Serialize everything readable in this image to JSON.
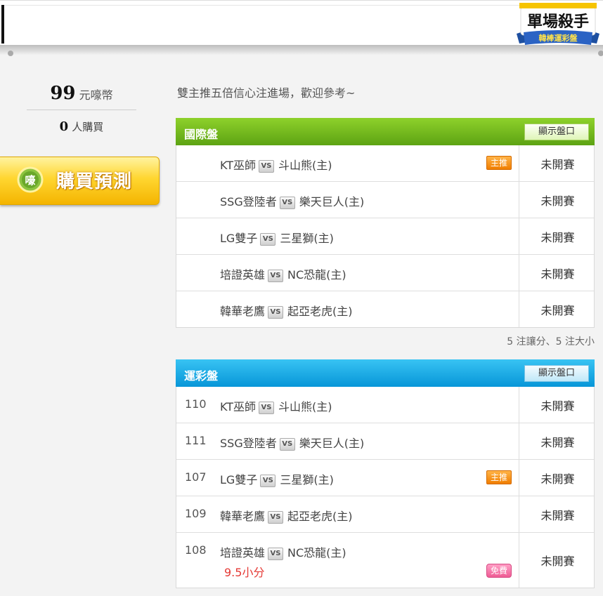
{
  "badge": {
    "line1": "單場殺手",
    "line2": "韓棒運彩盤"
  },
  "price": {
    "value": "99",
    "unit": "元嚎幣"
  },
  "buyers": {
    "value": "0",
    "unit": "人購買"
  },
  "buy_button": {
    "label": "購買預測",
    "coin_text": "嚎"
  },
  "intro": "雙主推五倍信心注進場，歡迎參考~",
  "vs_label": "VS",
  "sections": [
    {
      "title": "國際盤",
      "button": "顯示盤口",
      "rows": [
        {
          "num": "",
          "away": "KT巫師",
          "home": "斗山熊(主)",
          "tag": "主推",
          "status": "未開賽"
        },
        {
          "num": "",
          "away": "SSG登陸者",
          "home": "樂天巨人(主)",
          "tag": "",
          "status": "未開賽"
        },
        {
          "num": "",
          "away": "LG雙子",
          "home": "三星獅(主)",
          "tag": "",
          "status": "未開賽"
        },
        {
          "num": "",
          "away": "培證英雄",
          "home": "NC恐龍(主)",
          "tag": "",
          "status": "未開賽"
        },
        {
          "num": "",
          "away": "韓華老鷹",
          "home": "起亞老虎(主)",
          "tag": "",
          "status": "未開賽"
        }
      ],
      "note": "5 注讓分、5 注大小"
    },
    {
      "title": "運彩盤",
      "button": "顯示盤口",
      "rows": [
        {
          "num": "110",
          "away": "KT巫師",
          "home": "斗山熊(主)",
          "tag": "",
          "status": "未開賽"
        },
        {
          "num": "111",
          "away": "SSG登陸者",
          "home": "樂天巨人(主)",
          "tag": "",
          "status": "未開賽"
        },
        {
          "num": "107",
          "away": "LG雙子",
          "home": "三星獅(主)",
          "tag": "主推",
          "status": "未開賽"
        },
        {
          "num": "109",
          "away": "韓華老鷹",
          "home": "起亞老虎(主)",
          "tag": "",
          "status": "未開賽"
        },
        {
          "num": "108",
          "away": "培證英雄",
          "home": "NC恐龍(主)",
          "tag": "免費",
          "pick": "9.5小分",
          "status": "未開賽"
        }
      ]
    }
  ]
}
